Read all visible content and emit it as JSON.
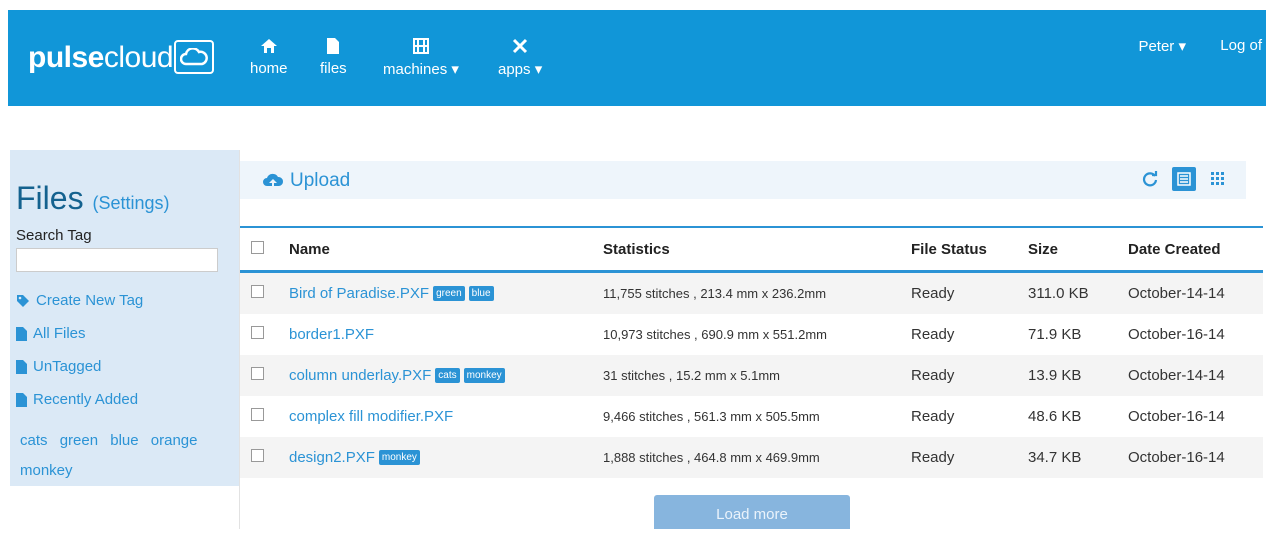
{
  "brand": {
    "name_bold": "pulse",
    "name_rest": "cloud",
    "icon": "cloud-icon"
  },
  "nav": [
    {
      "label": "home",
      "icon": "home-icon"
    },
    {
      "label": "files",
      "icon": "file-icon"
    },
    {
      "label": "machines",
      "icon": "machine-icon",
      "dropdown": true
    },
    {
      "label": "apps",
      "icon": "tools-icon",
      "dropdown": true
    }
  ],
  "user": {
    "name": "Peter",
    "logout": "Log of"
  },
  "sidebar": {
    "title": "Files",
    "settings": "(Settings)",
    "search_label": "Search Tag",
    "search_value": "",
    "links": {
      "create_tag": "Create New Tag",
      "all_files": "All Files",
      "untagged": "UnTagged",
      "recent": "Recently Added"
    },
    "tags": [
      "cats",
      "green",
      "blue",
      "orange",
      "monkey"
    ]
  },
  "toolbar": {
    "upload": "Upload",
    "icons": [
      "refresh-icon",
      "list-view-icon",
      "grid-view-icon"
    ]
  },
  "table": {
    "columns": [
      "Name",
      "Statistics",
      "File Status",
      "Size",
      "Date Created"
    ],
    "rows": [
      {
        "name": "Bird of Paradise.PXF",
        "tags": [
          "green",
          "blue"
        ],
        "stats": "11,755 stitches , 213.4 mm x 236.2mm",
        "status": "Ready",
        "size": "311.0 KB",
        "date": "October-14-14"
      },
      {
        "name": "border1.PXF",
        "tags": [],
        "stats": "10,973 stitches , 690.9 mm x 551.2mm",
        "status": "Ready",
        "size": "71.9 KB",
        "date": "October-16-14"
      },
      {
        "name": "column underlay.PXF",
        "tags": [
          "cats",
          "monkey"
        ],
        "stats": "31 stitches , 15.2 mm x 5.1mm",
        "status": "Ready",
        "size": "13.9 KB",
        "date": "October-14-14"
      },
      {
        "name": "complex fill modifier.PXF",
        "tags": [],
        "stats": "9,466 stitches , 561.3 mm x 505.5mm",
        "status": "Ready",
        "size": "48.6 KB",
        "date": "October-16-14"
      },
      {
        "name": "design2.PXF",
        "tags": [
          "monkey"
        ],
        "stats": "1,888 stitches , 464.8 mm x 469.9mm",
        "status": "Ready",
        "size": "34.7 KB",
        "date": "October-16-14"
      }
    ]
  },
  "load_more": "Load more",
  "colors": {
    "primary": "#1196d8",
    "link": "#2b93d5",
    "sidebar_bg": "#dbe9f6",
    "tag_bg": "#2b93d5"
  }
}
